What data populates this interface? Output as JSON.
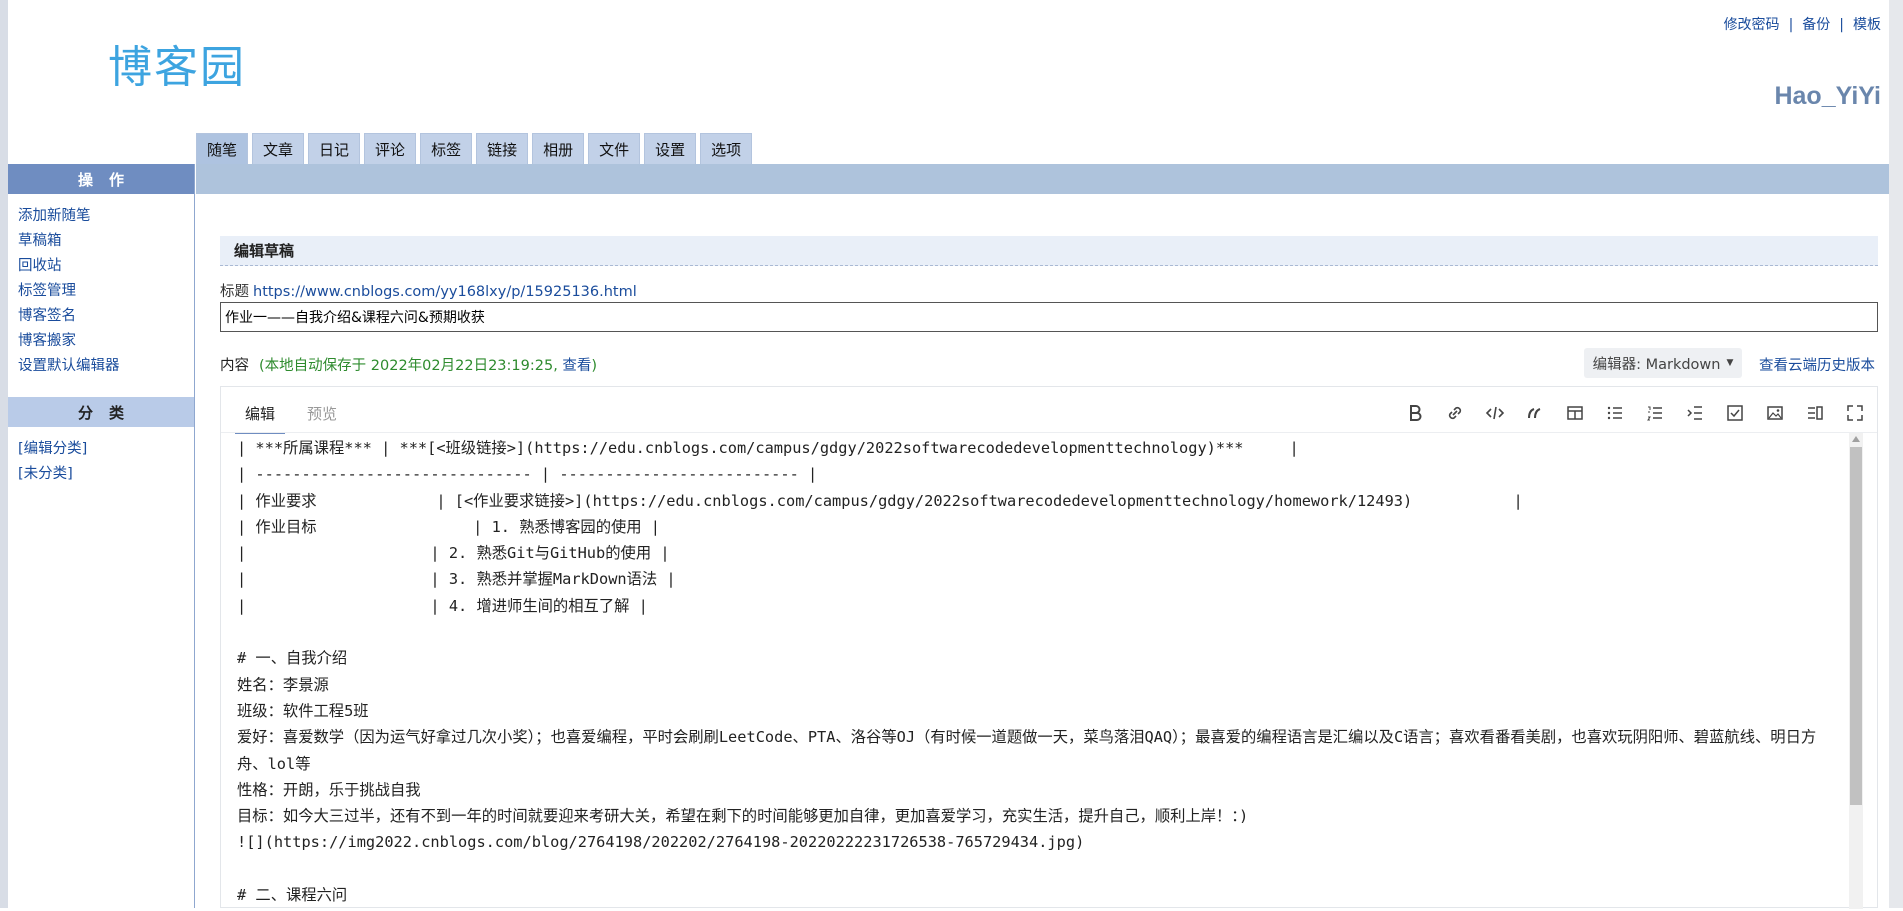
{
  "header": {
    "logo_text": "博客园",
    "links": [
      "修改密码",
      "备份",
      "模板"
    ],
    "user_name": "Hao_YiYi"
  },
  "tabs": [
    "随笔",
    "文章",
    "日记",
    "评论",
    "标签",
    "链接",
    "相册",
    "文件",
    "设置",
    "选项"
  ],
  "sidebar": {
    "ops_title": "操作",
    "ops_items": [
      "添加新随笔",
      "草稿箱",
      "回收站",
      "标签管理",
      "博客签名",
      "博客搬家",
      "设置默认编辑器"
    ],
    "cat_title": "分类",
    "cat_items": [
      "[编辑分类]",
      "[未分类]"
    ]
  },
  "main": {
    "section_title": "编辑草稿",
    "title_label": "标题",
    "title_url": "https://www.cnblogs.com/yy168lxy/p/15925136.html",
    "title_value": "作业一——自我介绍&课程六问&预期收获",
    "content_label": "内容",
    "autosave_text": "(本地自动保存于 2022年02月22日23:19:25,",
    "autosave_link": "查看",
    "autosave_end": ")",
    "editor_select": "编辑器: Markdown",
    "history_link": "查看云端历史版本"
  },
  "editor": {
    "tabs": [
      "编辑",
      "预览"
    ],
    "toolbar": [
      "bold-icon",
      "link-icon",
      "code-icon",
      "quote-icon",
      "table-icon",
      "unordered-list-icon",
      "ordered-list-icon",
      "indent-icon",
      "checkbox-icon",
      "image-icon",
      "split-view-icon",
      "fullscreen-icon"
    ],
    "content": "| ***所属课程*** | ***[<班级链接>](https://edu.cnblogs.com/campus/gdgy/2022softwarecodedevelopmenttechnology)***     |\n| ------------------------------ | -------------------------- |\n| 作业要求             | [<作业要求链接>](https://edu.cnblogs.com/campus/gdgy/2022softwarecodedevelopmenttechnology/homework/12493)           |\n| 作业目标                 | 1. 熟悉博客园的使用 |\n|                    | 2. 熟悉Git与GitHub的使用 |\n|                    | 3. 熟悉并掌握MarkDown语法 |\n|                    | 4. 增进师生间的相互了解 |\n\n# 一、自我介绍\n姓名：李景源\n班级：软件工程5班\n爱好：喜爱数学（因为运气好拿过几次小奖）；也喜爱编程，平时会刷刷LeetCode、PTA、洛谷等OJ（有时候一道题做一天，菜鸟落泪QAQ）；最喜爱的编程语言是汇编以及C语言；喜欢看番看美剧，也喜欢玩阴阳师、碧蓝航线、明日方舟、lol等\n性格：开朗，乐于挑战自我\n目标：如今大三过半，还有不到一年的时间就要迎来考研大关，希望在剩下的时间能够更加自律，更加喜爱学习，充实生活，提升自己，顺利上岸！：)\n![](https://img2022.cnblogs.com/blog/2764198/202202/2764198-20220222231726538-765729434.jpg)\n\n# 二、课程六问"
  },
  "colors": {
    "accent": "#6f8dc1",
    "tab_bg": "#c2d1e8",
    "link": "#1a4c9c",
    "autosave": "#2e8b2e"
  }
}
